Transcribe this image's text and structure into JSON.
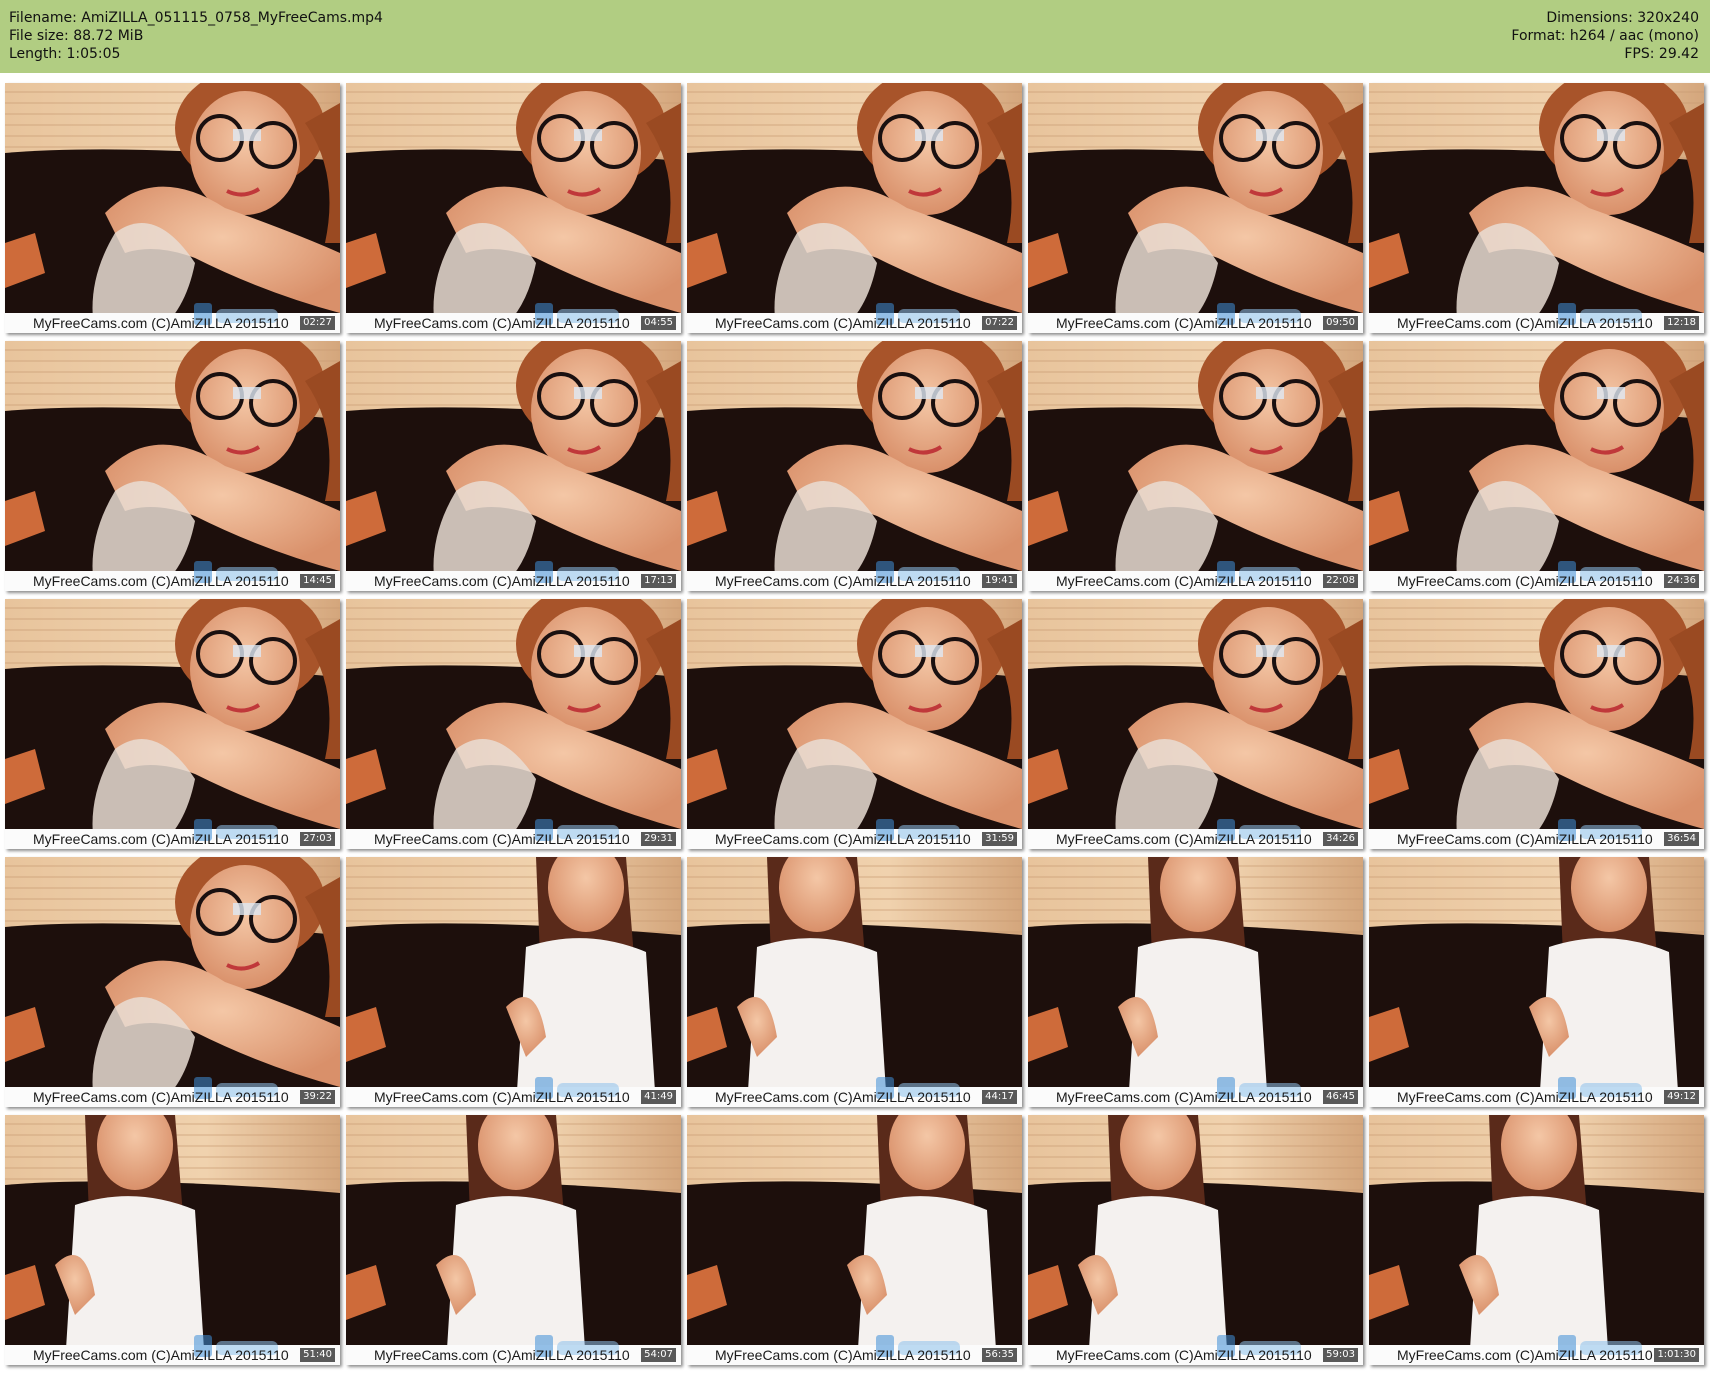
{
  "header": {
    "filename": "Filename: AmiZILLA_051115_0758_MyFreeCams.mp4",
    "filesize": "File size: 88.72 MiB",
    "length": "Length: 1:05:05",
    "dimensions": "Dimensions: 320x240",
    "format": "Format: h264 / aac (mono)",
    "fps": "FPS: 29.42"
  },
  "watermark": "MyFreeCams.com (C)AmiZILLA 2015110",
  "thumbnails": [
    {
      "time": "02:27"
    },
    {
      "time": "04:55"
    },
    {
      "time": "07:22"
    },
    {
      "time": "09:50"
    },
    {
      "time": "12:18"
    },
    {
      "time": "14:45"
    },
    {
      "time": "17:13"
    },
    {
      "time": "19:41"
    },
    {
      "time": "22:08"
    },
    {
      "time": "24:36"
    },
    {
      "time": "27:03"
    },
    {
      "time": "29:31"
    },
    {
      "time": "31:59"
    },
    {
      "time": "34:26"
    },
    {
      "time": "36:54"
    },
    {
      "time": "39:22"
    },
    {
      "time": "41:49"
    },
    {
      "time": "44:17"
    },
    {
      "time": "46:45"
    },
    {
      "time": "49:12"
    },
    {
      "time": "51:40"
    },
    {
      "time": "54:07"
    },
    {
      "time": "56:35"
    },
    {
      "time": "59:03"
    },
    {
      "time": "1:01:30"
    }
  ]
}
